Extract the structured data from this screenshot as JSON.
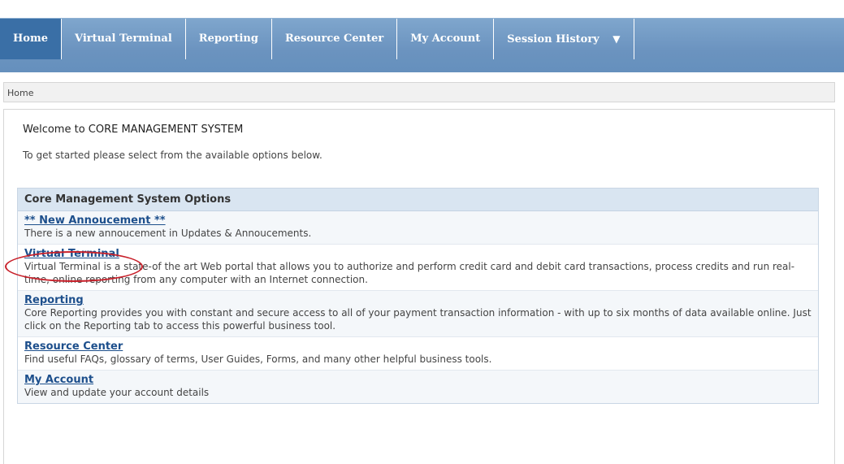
{
  "nav": {
    "tabs": [
      {
        "label": "Home",
        "active": true
      },
      {
        "label": "Virtual Terminal",
        "active": false
      },
      {
        "label": "Reporting",
        "active": false
      },
      {
        "label": "Resource Center",
        "active": false
      },
      {
        "label": "My Account",
        "active": false
      },
      {
        "label": "Session History",
        "active": false,
        "has_dropdown": true
      }
    ]
  },
  "breadcrumb": "Home",
  "welcome": {
    "title": "Welcome to CORE MANAGEMENT SYSTEM",
    "subtitle": "To get started please select from the available options below."
  },
  "options": {
    "header": "Core Management System Options",
    "items": [
      {
        "label": "** New Annoucement **",
        "description": "There is a new annoucement in Updates & Annoucements."
      },
      {
        "label": "Virtual Terminal",
        "description": "Virtual Terminal is a state-of the art Web portal that allows you to authorize and perform credit card and debit card transactions, process credits and run real-time, online reporting from any computer with an Internet connection."
      },
      {
        "label": "Reporting",
        "description": "Core Reporting provides you with constant and secure access to all of your payment transaction information - with up to six months of data available online. Just click on the Reporting tab to access this powerful business tool."
      },
      {
        "label": "Resource Center",
        "description": "Find useful FAQs, glossary of terms, User Guides, Forms, and many other helpful business tools."
      },
      {
        "label": "My Account",
        "description": "View and update your account details"
      }
    ]
  },
  "colors": {
    "nav_bg": "#6b93bf",
    "active_tab": "#3a6fa6",
    "link": "#1d4f8c",
    "highlight": "#c8202a"
  },
  "icons": {
    "session_history_caret": "chevron-down-icon"
  }
}
